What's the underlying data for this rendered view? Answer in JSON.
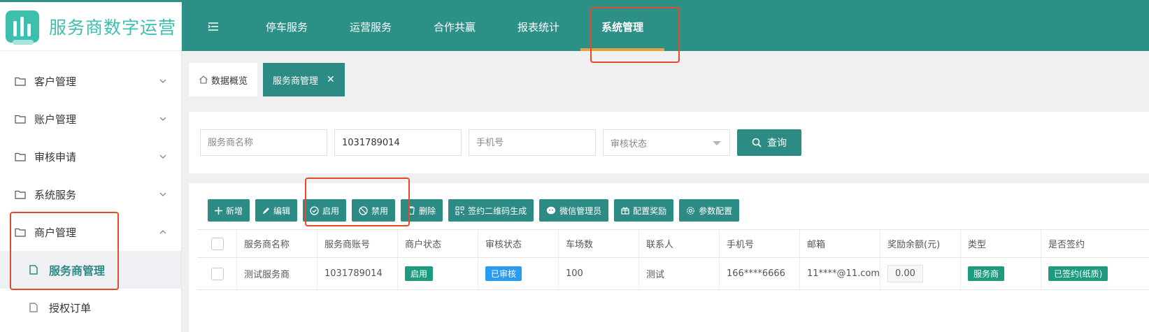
{
  "brand": {
    "name": "服务商数字运营"
  },
  "sidebar": {
    "items": [
      {
        "label": "客户管理",
        "expanded": false
      },
      {
        "label": "账户管理",
        "expanded": false
      },
      {
        "label": "审核申请",
        "expanded": false
      },
      {
        "label": "系统服务",
        "expanded": false
      },
      {
        "label": "商户管理",
        "expanded": true
      }
    ],
    "subitems": [
      {
        "label": "服务商管理",
        "active": true
      },
      {
        "label": "授权订单",
        "active": false
      }
    ]
  },
  "topnav": {
    "items": [
      "停车服务",
      "运营服务",
      "合作共赢",
      "报表统计",
      "系统管理"
    ],
    "active": "系统管理",
    "accent": "#e8a33d"
  },
  "tabs": [
    {
      "label": "数据概览",
      "active": false
    },
    {
      "label": "服务商管理",
      "active": true
    }
  ],
  "filters": {
    "name_placeholder": "服务商名称",
    "account_value": "1031789014",
    "phone_placeholder": "手机号",
    "audit_placeholder": "审核状态",
    "query_label": "查询"
  },
  "toolbar": {
    "add": "新增",
    "edit": "编辑",
    "enable": "启用",
    "disable": "禁用",
    "delete": "删除",
    "qrcode": "签约二维码生成",
    "wechat": "微信管理员",
    "reward": "配置奖励",
    "params": "参数配置"
  },
  "table": {
    "columns": [
      "服务商名称",
      "服务商账号",
      "商户状态",
      "审核状态",
      "车场数",
      "联系人",
      "手机号",
      "邮箱",
      "奖励余额(元)",
      "类型",
      "是否签约"
    ],
    "rows": [
      {
        "name": "测试服务商",
        "account": "1031789014",
        "merchant_status": "启用",
        "audit_status": "已审核",
        "lots": "100",
        "contact": "测试",
        "phone": "166****6666",
        "email": "11****@11.com",
        "balance": "0.00",
        "type": "服务商",
        "signed": "已签约(纸质)"
      }
    ]
  },
  "colors": {
    "primary": "#2d8b85",
    "header": "#2d9086",
    "highlight": "#e24a2a"
  }
}
